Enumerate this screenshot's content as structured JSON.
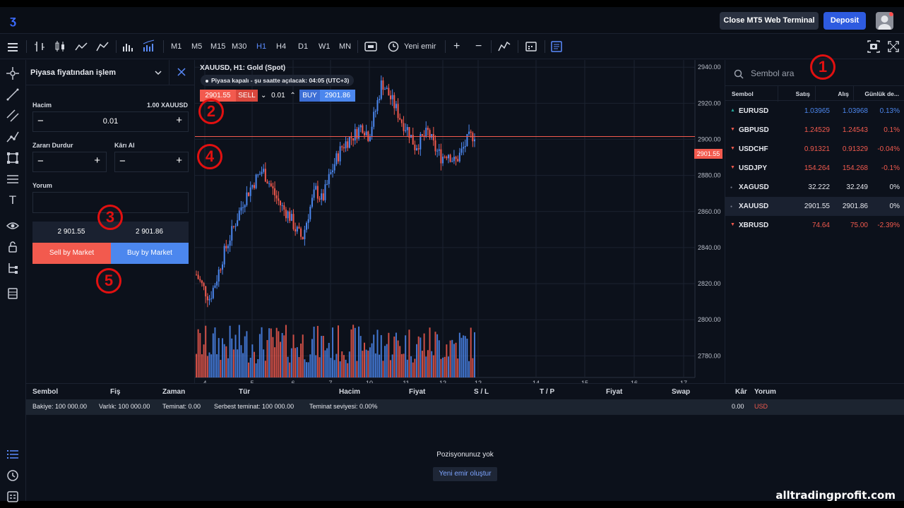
{
  "topbar": {
    "close_label": "Close MT5 Web Terminal",
    "deposit_label": "Deposit"
  },
  "toolbar": {
    "timeframes": [
      "M1",
      "M5",
      "M15",
      "M30",
      "H1",
      "H4",
      "D1",
      "W1",
      "MN"
    ],
    "active_timeframe": "H1",
    "new_order_label": "Yeni emir"
  },
  "order_panel": {
    "title": "Piyasa fiyatından işlem",
    "volume_label": "Hacim",
    "volume_unit": "1.00 XAUUSD",
    "volume_value": "0.01",
    "stop_loss_label": "Zararı Durdur",
    "take_profit_label": "Kârı Al",
    "comment_label": "Yorum",
    "sell_price": "2 901.55",
    "buy_price": "2 901.86",
    "sell_button": "Sell by Market",
    "buy_button": "Buy by Market"
  },
  "chart_header": {
    "title": "XAUUSD, H1: Gold (Spot)",
    "status": "Piyasa kapalı - şu saatte açılacak: 04:05 (UTC+3)",
    "sell_price": "2901.55",
    "sell_label": "SELL",
    "lot": "0.01",
    "buy_label": "BUY",
    "buy_price": "2901.86",
    "current_price_tag": "2901.55"
  },
  "chart_data": {
    "type": "candlestick",
    "symbol": "XAUUSD",
    "timeframe": "H1",
    "x_ticks": [
      "4",
      "5",
      "6",
      "7",
      "10",
      "11",
      "12",
      "12",
      "14",
      "15",
      "16",
      "17"
    ],
    "y_ticks": [
      "2940.00",
      "2920.00",
      "2900.00",
      "2880.00",
      "2860.00",
      "2840.00",
      "2820.00",
      "2800.00",
      "2780.00"
    ],
    "ylim": [
      2768,
      2944
    ],
    "current_price": 2901.55,
    "close_path": [
      2825,
      2818,
      2812,
      2822,
      2835,
      2845,
      2855,
      2865,
      2872,
      2878,
      2883,
      2876,
      2868,
      2862,
      2858,
      2850,
      2845,
      2860,
      2872,
      2866,
      2878,
      2888,
      2896,
      2900,
      2903,
      2908,
      2902,
      2915,
      2932,
      2925,
      2918,
      2910,
      2905,
      2896,
      2900,
      2904,
      2895,
      2890,
      2893,
      2887,
      2893,
      2900,
      2903
    ]
  },
  "watchlist": {
    "search_placeholder": "Sembol ara",
    "headers": [
      "Sembol",
      "Satış",
      "Alış",
      "Günlük de..."
    ],
    "rows": [
      {
        "symbol": "EURUSD",
        "bid": "1.03965",
        "ask": "1.03968",
        "change": "0.13%",
        "dir": "up"
      },
      {
        "symbol": "GBPUSD",
        "bid": "1.24529",
        "ask": "1.24543",
        "change": "0.1%",
        "dir": "down"
      },
      {
        "symbol": "USDCHF",
        "bid": "0.91321",
        "ask": "0.91329",
        "change": "-0.04%",
        "dir": "down"
      },
      {
        "symbol": "USDJPY",
        "bid": "154.264",
        "ask": "154.268",
        "change": "-0.1%",
        "dir": "down"
      },
      {
        "symbol": "XAGUSD",
        "bid": "32.222",
        "ask": "32.249",
        "change": "0%",
        "dir": "flat"
      },
      {
        "symbol": "XAUUSD",
        "bid": "2901.55",
        "ask": "2901.86",
        "change": "0%",
        "dir": "flat"
      },
      {
        "symbol": "XBRUSD",
        "bid": "74.64",
        "ask": "75.00",
        "change": "-2.39%",
        "dir": "down"
      }
    ]
  },
  "positions": {
    "headers": [
      "Sembol",
      "Fiş",
      "Zaman",
      "Tür",
      "Hacim",
      "Fiyat",
      "S / L",
      "T / P",
      "Fiyat",
      "Swap",
      "Kâr",
      "Yorum"
    ],
    "balance": "Bakiye: 100 000.00",
    "equity": "Varlık: 100 000.00",
    "margin": "Teminat: 0.00",
    "free_margin": "Serbest teminat: 100 000.00",
    "margin_level": "Teminat seviyesi: 0.00%",
    "profit": "0.00",
    "currency": "USD",
    "empty_text": "Pozisyonunuz yok",
    "new_order_button": "Yeni emir oluştur"
  },
  "annotations": [
    "1",
    "2",
    "3",
    "4",
    "5"
  ],
  "watermark": "alltradingprofit.com",
  "colors": {
    "accent": "#2e5be0",
    "up": "#4c87ee",
    "down": "#f25a4e",
    "green": "#26a69a"
  }
}
